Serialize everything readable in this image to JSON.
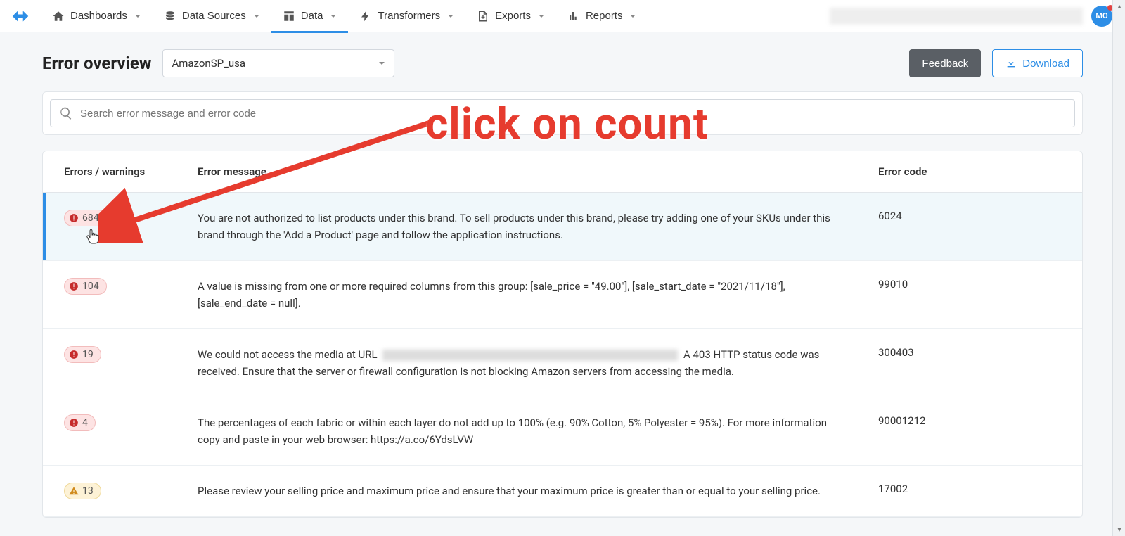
{
  "nav": {
    "items": [
      {
        "label": "Dashboards"
      },
      {
        "label": "Data Sources"
      },
      {
        "label": "Data"
      },
      {
        "label": "Transformers"
      },
      {
        "label": "Exports"
      },
      {
        "label": "Reports"
      }
    ],
    "avatar_initials": "MO"
  },
  "page": {
    "title": "Error overview",
    "selector_value": "AmazonSP_usa",
    "feedback_label": "Feedback",
    "download_label": "Download",
    "search_placeholder": "Search error message and error code"
  },
  "table": {
    "headers": {
      "count": "Errors / warnings",
      "message": "Error message",
      "code": "Error code"
    },
    "rows": [
      {
        "type": "error",
        "count": "684",
        "message": "You are not authorized to list products under this brand. To sell products under this brand, please try adding one of your SKUs under this brand through the 'Add a Product' page and follow the application instructions.",
        "code": "6024",
        "active": true
      },
      {
        "type": "error",
        "count": "104",
        "message": "A value is missing from one or more required columns from this group: [sale_price = \"49.00\"], [sale_start_date = \"2021/11/18\"], [sale_end_date = null].",
        "code": "99010"
      },
      {
        "type": "error",
        "count": "19",
        "message_pre": "We could not access the media at URL",
        "message_post": "A 403 HTTP status code was received. Ensure that the server or firewall configuration is not blocking Amazon servers from accessing the media.",
        "code": "300403",
        "url_hidden": true
      },
      {
        "type": "error",
        "count": "4",
        "message": "The percentages of each fabric or within each layer do not add up to 100% (e.g. 90% Cotton, 5% Polyester = 95%). For more information copy and paste in your web browser: https://a.co/6YdsLVW",
        "code": "90001212"
      },
      {
        "type": "warning",
        "count": "13",
        "message": "Please review your selling price and maximum price and ensure that your maximum price is greater than or equal to your selling price.",
        "code": "17002"
      }
    ]
  },
  "annotation": {
    "text": "click on count"
  }
}
